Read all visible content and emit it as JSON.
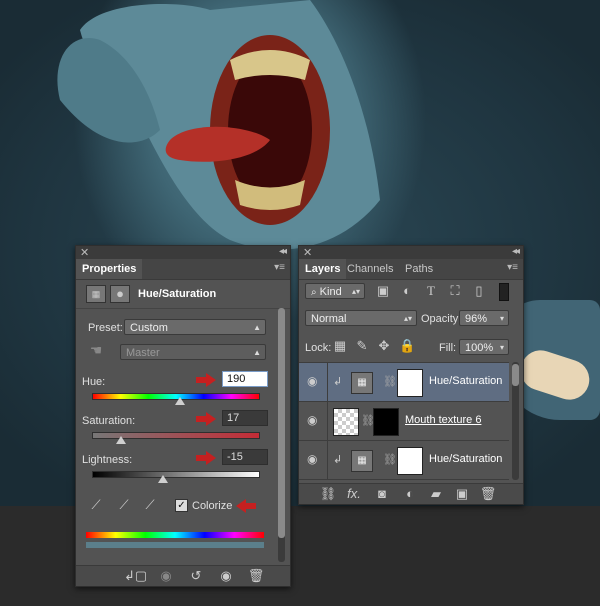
{
  "properties": {
    "tab": "Properties",
    "adjustment_title": "Hue/Saturation",
    "preset_label": "Preset:",
    "preset_value": "Custom",
    "channel_value": "Master",
    "hue_label": "Hue:",
    "hue_value": "190",
    "saturation_label": "Saturation:",
    "saturation_value": "17",
    "lightness_label": "Lightness:",
    "lightness_value": "-15",
    "colorize_label": "Colorize",
    "colorize_checked": true
  },
  "layers": {
    "tabs": [
      "Layers",
      "Channels",
      "Paths"
    ],
    "kind_value": "Kind",
    "blend_mode": "Normal",
    "opacity_label": "Opacity:",
    "opacity_value": "96%",
    "lock_label": "Lock:",
    "fill_label": "Fill:",
    "fill_value": "100%",
    "rows": [
      {
        "name": "Hue/Saturation",
        "selected": true
      },
      {
        "name": "Mouth texture 6",
        "selected": false
      },
      {
        "name": "Hue/Saturation",
        "selected": false
      }
    ],
    "fx_label": "fx."
  },
  "colors": {
    "arrow": "#c52020",
    "selected_row": "#5f6d82",
    "panel_bg": "#535353"
  }
}
